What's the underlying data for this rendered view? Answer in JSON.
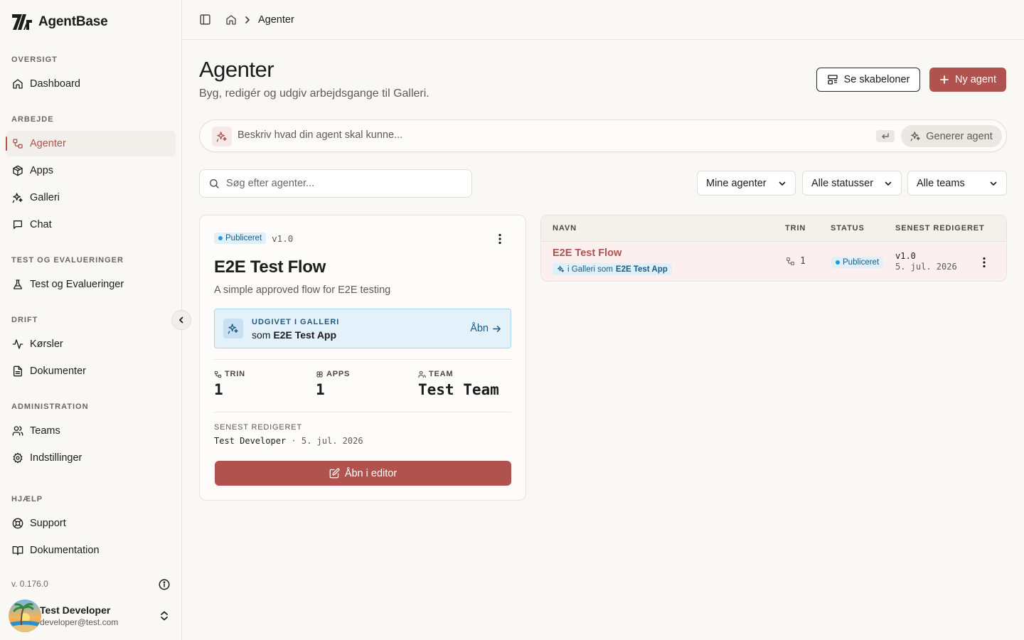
{
  "app": {
    "name": "AgentBase"
  },
  "sidebar": {
    "sections": [
      {
        "label": "OVERSIGT",
        "items": [
          {
            "label": "Dashboard",
            "icon": "home-icon"
          }
        ]
      },
      {
        "label": "ARBEJDE",
        "items": [
          {
            "label": "Agenter",
            "icon": "workflow-icon",
            "active": true
          },
          {
            "label": "Apps",
            "icon": "package-icon"
          },
          {
            "label": "Galleri",
            "icon": "sparkles-icon"
          },
          {
            "label": "Chat",
            "icon": "chat-icon"
          }
        ]
      },
      {
        "label": "TEST OG EVALUERINGER",
        "items": [
          {
            "label": "Test og Evalueringer",
            "icon": "flask-icon"
          }
        ]
      },
      {
        "label": "DRIFT",
        "items": [
          {
            "label": "Kørsler",
            "icon": "activity-icon"
          },
          {
            "label": "Dokumenter",
            "icon": "document-icon"
          }
        ]
      },
      {
        "label": "ADMINISTRATION",
        "items": [
          {
            "label": "Teams",
            "icon": "users-icon"
          },
          {
            "label": "Indstillinger",
            "icon": "settings-icon"
          }
        ]
      },
      {
        "label": "HJÆLP",
        "items": [
          {
            "label": "Support",
            "icon": "lifebuoy-icon"
          },
          {
            "label": "Dokumentation",
            "icon": "book-icon"
          }
        ]
      }
    ],
    "version": "v. 0.176.0",
    "user": {
      "name": "Test Developer",
      "email": "developer@test.com"
    }
  },
  "breadcrumb": {
    "current": "Agenter"
  },
  "header": {
    "title": "Agenter",
    "subtitle": "Byg, redigér og udgiv arbejdsgange til Galleri.",
    "templates_button": "Se skabeloner",
    "new_button": "Ny agent"
  },
  "prompt": {
    "placeholder": "Beskriv hvad din agent skal kunne...",
    "generate_button": "Generer agent"
  },
  "search": {
    "placeholder": "Søg efter agenter..."
  },
  "filters": {
    "owner": "Mine agenter",
    "status": "Alle statusser",
    "team": "Alle teams"
  },
  "card": {
    "status": "Publiceret",
    "version": "v1.0",
    "title": "E2E Test Flow",
    "description": "A simple approved flow for E2E testing",
    "published_label": "UDGIVET I GALLERI",
    "published_prefix": "som",
    "published_app": "E2E Test App",
    "open_link": "Åbn",
    "stats": [
      {
        "label": "TRIN",
        "value": "1"
      },
      {
        "label": "APPS",
        "value": "1"
      },
      {
        "label": "TEAM",
        "value": "Test Team"
      }
    ],
    "edited_label": "SENEST REDIGERET",
    "edited_by": "Test Developer",
    "edited_sep": "·",
    "edited_date": "5. jul. 2026",
    "editor_button": "Åbn i editor"
  },
  "table": {
    "columns": [
      "NAVN",
      "TRIN",
      "STATUS",
      "SENEST REDIGERET"
    ],
    "rows": [
      {
        "name": "E2E Test Flow",
        "gallery_prefix": "i Galleri som",
        "gallery_app": "E2E Test App",
        "steps": "1",
        "status": "Publiceret",
        "version": "v1.0",
        "date": "5. jul. 2026"
      }
    ]
  },
  "colors": {
    "accent": "#b0524e",
    "info": "#1c5a80",
    "status_dot": "#2196e6"
  }
}
